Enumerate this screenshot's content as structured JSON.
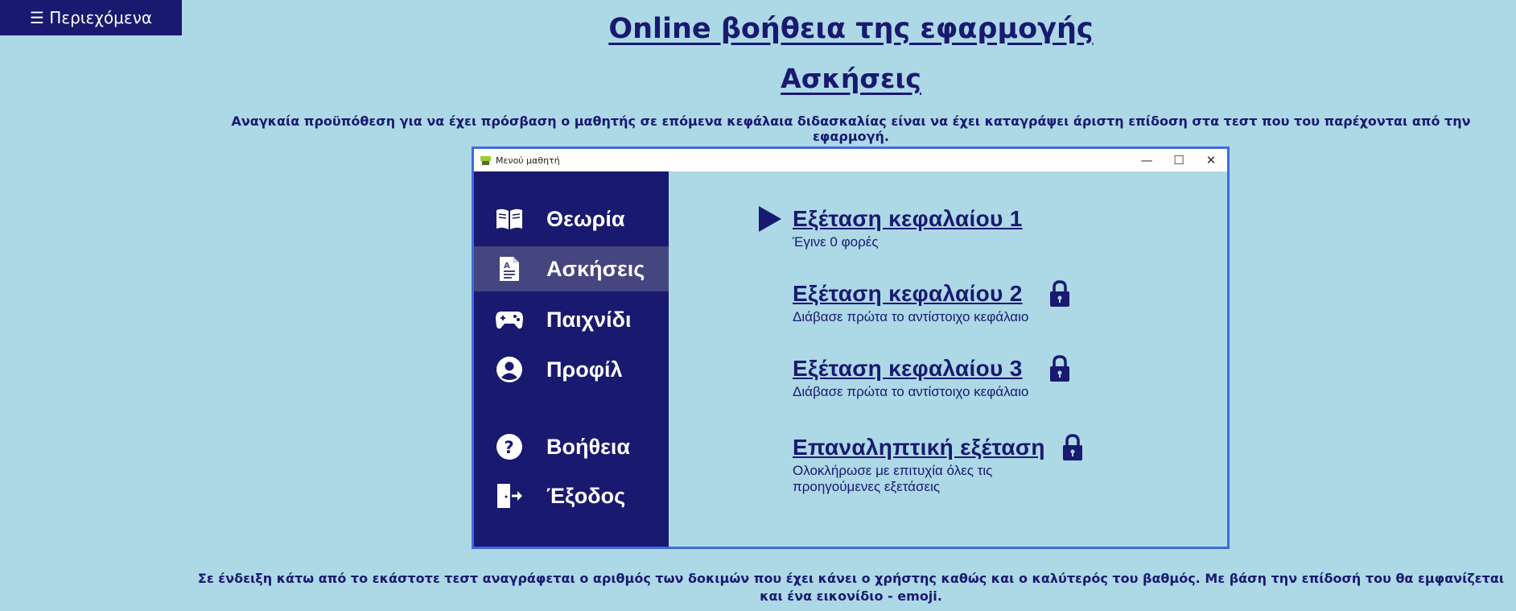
{
  "toc_button": {
    "label": "☰ Περιεχόμενα"
  },
  "page_title": "Online βοήθεια της εφαρμογής",
  "section_title": "Ασκήσεις",
  "intro_text": "Αναγκαία προϋπόθεση για να έχει πρόσβαση ο μαθητής σε επόμενα κεφάλαια διδασκαλίας είναι να έχει καταγράψει άριστη επίδοση στα τεστ που του παρέχονται από την εφαρμογή.",
  "window": {
    "title": "Μενού μαθητή",
    "controls": {
      "minimize": "—",
      "maximize": "☐",
      "close": "✕"
    },
    "sidebar": {
      "items": [
        {
          "label": "Θεωρία",
          "icon": "book-icon",
          "active": false
        },
        {
          "label": "Ασκήσεις",
          "icon": "exercise-document-icon",
          "active": true
        },
        {
          "label": "Παιχνίδι",
          "icon": "gamepad-icon",
          "active": false
        },
        {
          "label": "Προφίλ",
          "icon": "user-icon",
          "active": false
        },
        {
          "label": "Βοήθεια",
          "icon": "help-icon",
          "active": false
        },
        {
          "label": "Έξοδος",
          "icon": "exit-icon",
          "active": false
        }
      ]
    },
    "exams": [
      {
        "title": "Εξέταση κεφαλαίου 1",
        "subtitle": "Έγινε 0 φορές",
        "locked": false,
        "selected_icon": "play-icon"
      },
      {
        "title": "Εξέταση κεφαλαίου 2",
        "subtitle": "Διάβασε πρώτα το αντίστοιχο κεφάλαιο",
        "locked": true
      },
      {
        "title": "Εξέταση κεφαλαίου 3",
        "subtitle": "Διάβασε πρώτα το αντίστοιχο κεφάλαιο",
        "locked": true
      },
      {
        "title": "Επαναληπτική εξέταση",
        "subtitle_line1": "Ολοκλήρωσε με επιτυχία όλες τις",
        "subtitle_line2": "προηγούμενες εξετάσεις",
        "locked": true
      }
    ]
  },
  "footer_text": "Σε ένδειξη κάτω από το εκάστοτε τεστ αναγράφεται ο αριθμός των δοκιμών που έχει κάνει ο χρήστης καθώς και ο καλύτερός του βαθμός. Με βάση την επίδοσή του θα εμφανίζεται και ένα εικονίδιο - emoji.",
  "colors": {
    "background": "#add8e6",
    "navy": "#191970",
    "active_item": "#45457f",
    "window_border": "#4169e1"
  }
}
